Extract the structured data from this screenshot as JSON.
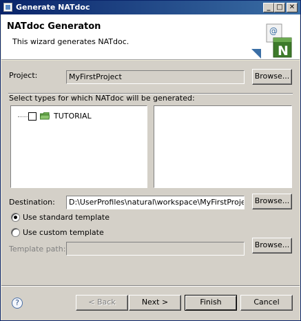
{
  "window": {
    "title": "Generate NATdoc",
    "controls": {
      "minimize": "_",
      "maximize": "□",
      "close": "✕"
    }
  },
  "banner": {
    "heading": "NATdoc Generaton",
    "description": "This wizard generates NATdoc.",
    "icon_letter": "N",
    "icon_at": "@"
  },
  "project": {
    "label": "Project:",
    "value": "MyFirstProject",
    "browse_label": "Browse..."
  },
  "types": {
    "label": "Select types for which NATdoc will be generated:",
    "tree": [
      {
        "label": "TUTORIAL",
        "checked": false
      }
    ]
  },
  "destination": {
    "label": "Destination:",
    "value": "D:\\UserProfiles\\natural\\workspace\\MyFirstProject\\d",
    "browse_label": "Browse..."
  },
  "template": {
    "standard_label": "Use standard template",
    "custom_label": "Use custom template",
    "selected": "standard",
    "path_label": "Template path:",
    "path_value": "",
    "browse_label": "Browse..."
  },
  "footer": {
    "help_icon": "?",
    "back_label": "< Back",
    "next_label": "Next >",
    "finish_label": "Finish",
    "cancel_label": "Cancel"
  },
  "colors": {
    "titlebar_start": "#0a246a",
    "titlebar_end": "#3a6ea5",
    "folder": "#6aa84f",
    "icon_green": "#3d7a2a"
  }
}
